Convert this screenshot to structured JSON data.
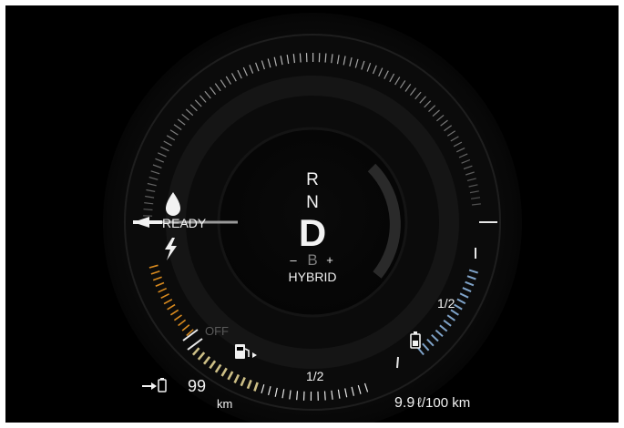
{
  "gear": {
    "options_above": [
      "R",
      "N"
    ],
    "current": "D",
    "brake_mode": "B",
    "brake_minus": "–",
    "brake_plus": "+",
    "drive_mode": "HYBRID"
  },
  "power_gauge": {
    "status": "READY",
    "off_label": "OFF",
    "charge_mark_label": "1/2"
  },
  "fuel": {
    "half_label": "1/2",
    "level_fraction": 0.4
  },
  "electric_range": {
    "value": "99",
    "unit": "km"
  },
  "consumption": {
    "value": "9.9",
    "unit": "ℓ/100 km"
  },
  "icons": {
    "drop": "oil-drop-icon",
    "bolt": "lightning-icon",
    "fuel_pump": "fuel-pump-icon",
    "battery": "battery-icon",
    "range_arrow_battery": "electric-range-icon"
  },
  "colors": {
    "background": "#000000",
    "text": "#f2f2f2",
    "fuel_fill": "#cdbf86",
    "charge_fill": "#7fa3c9",
    "orange": "#d98a1e",
    "dim": "#6b6b6b"
  }
}
